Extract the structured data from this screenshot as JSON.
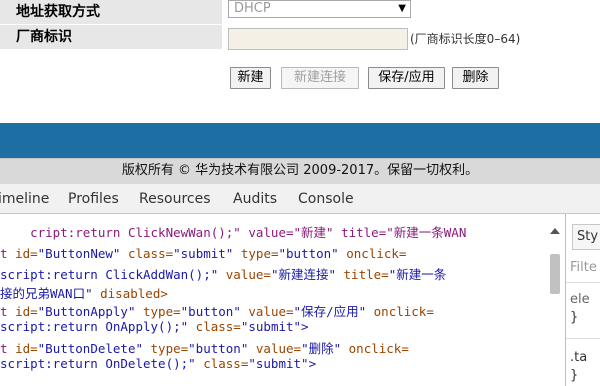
{
  "form": {
    "row1_label": "地址获取方式",
    "row1_select_value": "DHCP",
    "row2_label": "厂商标识",
    "row2_input_value": "",
    "row2_hint": "(厂商标识长度0–64)",
    "buttons": {
      "new": "新建",
      "new_connection": "新建连接",
      "save_apply": "保存/应用",
      "delete": "删除"
    }
  },
  "footer": {
    "copyright": "版权所有 © 华为技术有限公司 2009-2017。保留一切权利。"
  },
  "devtools": {
    "tabs": [
      "imeline",
      "Profiles",
      "Resources",
      "Audits",
      "Console"
    ],
    "code": {
      "line0": "cript:return ClickNewWan();\" value=\"新建\" title=\"新建一条WAN",
      "line1_tag": "t ",
      "line1_a1": "id=",
      "line1_v1": "\"ButtonNew\"",
      "line1_a2": " class=",
      "line1_v2": "\"submit\"",
      "line1_a3": " type=",
      "line1_v3": "\"button\"",
      "line1_a4": " onclick=",
      "line2_v": "script:return ClickAddWan();\"",
      "line2_a": " value=",
      "line2_v2": "\"新建连接\"",
      "line2_a2": " title=",
      "line2_v3": "\"新建一条",
      "line3_v": "接的兄弟WAN口\"",
      "line3_a": " disabled>",
      "line4_tag": "t ",
      "line4_a1": "id=",
      "line4_v1": "\"ButtonApply\"",
      "line4_a2": " type=",
      "line4_v2": "\"button\"",
      "line4_a3": " value=",
      "line4_v3": "\"保存/应用\"",
      "line4_a4": " onclick=",
      "line5_v": "script:return OnApply();\"",
      "line5_a": " class=",
      "line5_v2": "\"submit\">",
      "line6_tag": "t ",
      "line6_a1": "id=",
      "line6_v1": "\"ButtonDelete\"",
      "line6_a2": " type=",
      "line6_v2": "\"button\"",
      "line6_a3": " value=",
      "line6_v3": "\"删除\"",
      "line6_a4": " onclick=",
      "line7_v": "script:return OnDelete();\"",
      "line7_a": " class=",
      "line7_v2": "\"submit\">"
    },
    "styles": {
      "tab": "Sty",
      "filter": "Filte",
      "ele": "ele",
      "brace_close1": "}",
      "ta": ".ta",
      "brace_close2": "}"
    }
  },
  "colors": {
    "band": "#1d6fa3",
    "label_bg": "#e7e7e7",
    "input_bg": "#f4f0e6"
  }
}
